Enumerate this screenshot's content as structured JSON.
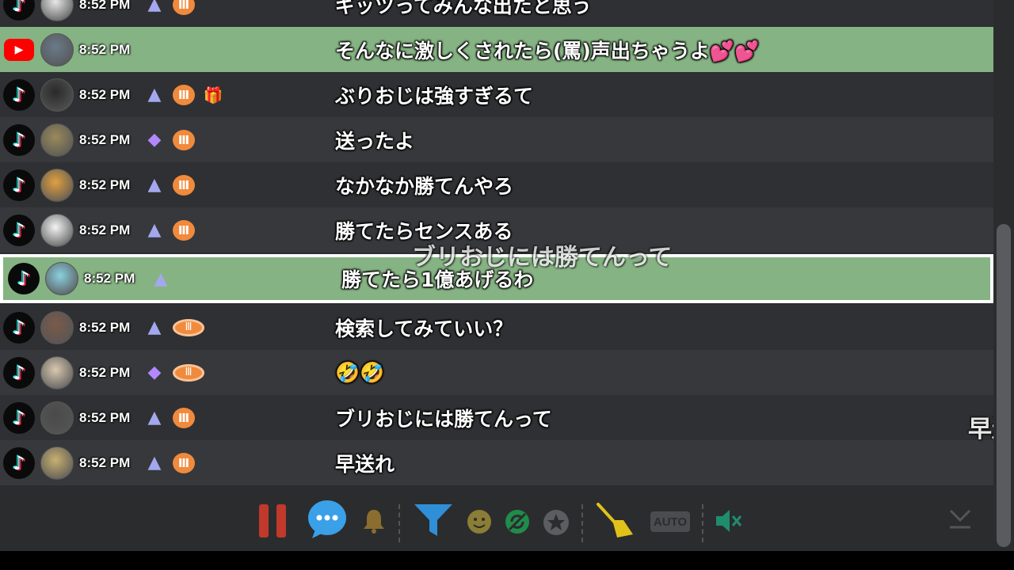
{
  "colors": {
    "highlight": "#86b383",
    "background": "#2d2e30",
    "heart": "#f08a3c"
  },
  "rows": [
    {
      "platform": "tiktok",
      "time": "8:52 PM",
      "badges": [
        "triangle",
        "heart"
      ],
      "message": "ギッツってみんな出たと思う",
      "style": "odd"
    },
    {
      "platform": "youtube",
      "time": "8:52 PM",
      "badges": [],
      "message": "そんなに激しくされたら(罵)声出ちゃうよ💕💕",
      "style": "highlight"
    },
    {
      "platform": "tiktok",
      "time": "8:52 PM",
      "badges": [
        "triangle",
        "heart",
        "gift"
      ],
      "message": "ぶりおじは強すぎるて",
      "style": "odd"
    },
    {
      "platform": "tiktok",
      "time": "8:52 PM",
      "badges": [
        "gem",
        "heart"
      ],
      "message": "送ったよ",
      "style": "even"
    },
    {
      "platform": "tiktok",
      "time": "8:52 PM",
      "badges": [
        "triangle",
        "heart"
      ],
      "message": "なかなか勝てんやろ",
      "style": "odd"
    },
    {
      "platform": "tiktok",
      "time": "8:52 PM",
      "badges": [
        "triangle",
        "heart"
      ],
      "message": "勝てたらセンスある",
      "style": "even"
    },
    {
      "platform": "tiktok",
      "time": "8:52 PM",
      "badges": [
        "triangle"
      ],
      "message": "勝てたら1億あげるわ",
      "style": "selected"
    },
    {
      "platform": "tiktok",
      "time": "8:52 PM",
      "badges": [
        "triangle",
        "ring"
      ],
      "message": "検索してみていい？",
      "style": "odd"
    },
    {
      "platform": "tiktok",
      "time": "8:52 PM",
      "badges": [
        "gem",
        "ring"
      ],
      "message": "🤣🤣",
      "style": "even"
    },
    {
      "platform": "tiktok",
      "time": "8:52 PM",
      "badges": [
        "triangle",
        "heart"
      ],
      "message": "ブリおじには勝てんって",
      "style": "odd"
    },
    {
      "platform": "tiktok",
      "time": "8:52 PM",
      "badges": [
        "triangle",
        "heart"
      ],
      "message": "早送れ",
      "style": "even"
    }
  ],
  "overlay_text": "ブリおじには勝てんって",
  "edge_text": "早送",
  "toolbar": {
    "auto_label": "AUTO"
  },
  "icons": {
    "pause": "pause-icon",
    "chat": "chat-bubble-icon",
    "bell": "bell-icon",
    "filter": "filter-icon",
    "emoji": "emoji-icon",
    "sync": "sync-icon",
    "star": "star-icon",
    "broom": "broom-icon",
    "auto": "auto-icon",
    "mute": "mute-icon",
    "scroll_down": "scroll-down-icon"
  }
}
